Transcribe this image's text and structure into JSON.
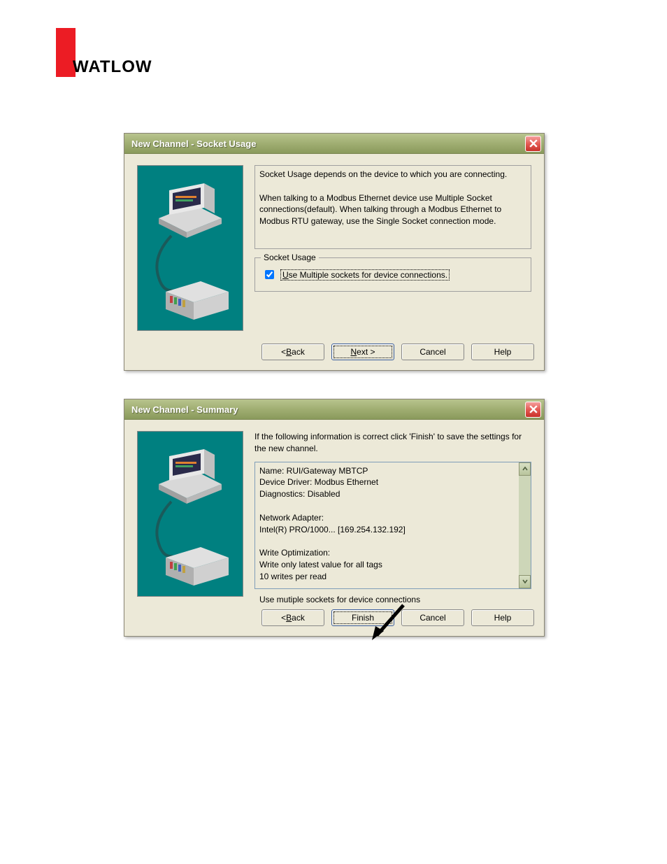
{
  "logo_text": "WATLOW",
  "dialog1": {
    "title": "New Channel - Socket Usage",
    "desc": "Socket Usage depends on the device to which you are connecting.\n\nWhen talking to a Modbus Ethernet device use Multiple Socket connections(default).  When talking through a Modbus Ethernet to Modbus RTU gateway, use the Single Socket connection mode.",
    "groupbox_label": "Socket Usage",
    "checkbox_label": "Use Multiple sockets for device connections.",
    "checkbox_checked": true,
    "buttons": {
      "back": "< Back",
      "next": "Next >",
      "cancel": "Cancel",
      "help": "Help"
    }
  },
  "dialog2": {
    "title": "New Channel - Summary",
    "desc": "If the following information is correct click 'Finish' to save the settings for the new channel.",
    "summary_text": "Name: RUI/Gateway MBTCP\nDevice Driver: Modbus Ethernet\nDiagnostics: Disabled\n\nNetwork Adapter:\nIntel(R) PRO/1000... [169.254.132.192]\n\nWrite Optimization:\nWrite only latest value for all tags\n10 writes per read\n\nUse mutiple sockets for device connections",
    "buttons": {
      "back": "< Back",
      "finish": "Finish",
      "cancel": "Cancel",
      "help": "Help"
    }
  }
}
